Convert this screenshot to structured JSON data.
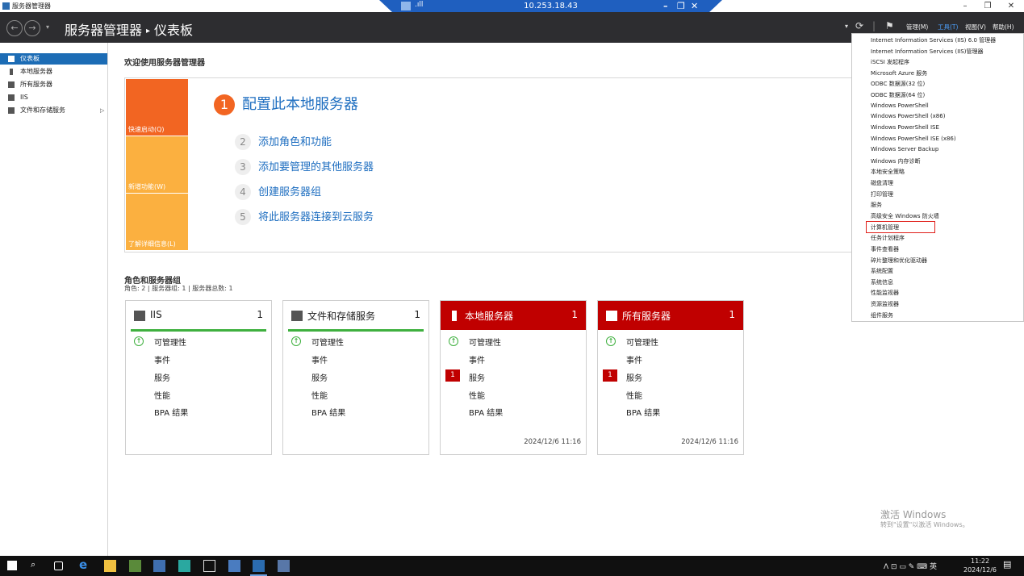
{
  "window": {
    "title": "服务器管理器",
    "minimize": "–",
    "restore": "❐",
    "close": "✕"
  },
  "remote": {
    "ip": "10.253.18.43",
    "signal": ".ıll",
    "min": "–",
    "restore": "❐",
    "close": "✕"
  },
  "header": {
    "breadcrumb": [
      "服务器管理器",
      "仪表板"
    ],
    "breadcrumb_sep": "▸",
    "menus": [
      "管理(M)",
      "工具(T)",
      "视图(V)",
      "帮助(H)"
    ],
    "refresh_icon": "⟳",
    "flag_icon": "⚑",
    "dropdown_arrow": "▾"
  },
  "sidebar": {
    "items": [
      {
        "label": "仪表板",
        "selected": true
      },
      {
        "label": "本地服务器"
      },
      {
        "label": "所有服务器"
      },
      {
        "label": "IIS"
      },
      {
        "label": "文件和存储服务",
        "arrow": "▷"
      }
    ]
  },
  "main": {
    "welcome": "欢迎使用服务器管理器",
    "quickstart": {
      "tiles": [
        "快速启动(Q)",
        "新增功能(W)",
        "了解详细信息(L)"
      ],
      "steps": [
        {
          "num": "1",
          "label": "配置此本地服务器"
        },
        {
          "num": "2",
          "label": "添加角色和功能"
        },
        {
          "num": "3",
          "label": "添加要管理的其他服务器"
        },
        {
          "num": "4",
          "label": "创建服务器组"
        },
        {
          "num": "5",
          "label": "将此服务器连接到云服务"
        }
      ]
    },
    "roles": {
      "title": "角色和服务器组",
      "subtitle": "角色: 2 | 服务器组: 1 | 服务器总数: 1",
      "cards": [
        {
          "title": "IIS",
          "count": "1",
          "rows": [
            "可管理性",
            "事件",
            "服务",
            "性能",
            "BPA 结果"
          ],
          "ok": "↑"
        },
        {
          "title": "文件和存储服务",
          "count": "1",
          "rows": [
            "可管理性",
            "事件",
            "服务",
            "性能",
            "BPA 结果"
          ],
          "ok": "↑"
        },
        {
          "title": "本地服务器",
          "count": "1",
          "rows": [
            "可管理性",
            "事件",
            "服务",
            "性能",
            "BPA 结果"
          ],
          "ok": "↑",
          "badge": "1",
          "timestamp": "2024/12/6 11:16"
        },
        {
          "title": "所有服务器",
          "count": "1",
          "rows": [
            "可管理性",
            "事件",
            "服务",
            "性能",
            "BPA 结果"
          ],
          "ok": "↑",
          "badge": "1",
          "timestamp": "2024/12/6 11:16"
        }
      ]
    }
  },
  "tools_menu": [
    "Internet Information Services (IIS) 6.0 管理器",
    "Internet Information Services (IIS)管理器",
    "iSCSI 发起程序",
    "Microsoft Azure 服务",
    "ODBC 数据源(32 位)",
    "ODBC 数据源(64 位)",
    "Windows PowerShell",
    "Windows PowerShell (x86)",
    "Windows PowerShell ISE",
    "Windows PowerShell ISE (x86)",
    "Windows Server Backup",
    "Windows 内存诊断",
    "本地安全策略",
    "磁盘清理",
    "打印管理",
    "服务",
    "高级安全 Windows 防火墙",
    "计算机管理",
    "任务计划程序",
    "事件查看器",
    "碎片整理和优化驱动器",
    "系统配置",
    "系统信息",
    "性能监视器",
    "资源监视器",
    "组件服务"
  ],
  "watermark": {
    "line1": "激活 Windows",
    "line2": "转到\"设置\"以激活 Windows。"
  },
  "taskbar": {
    "tray": "ᐱ  ⊡  ▭  ✎  ⌨  英",
    "time": "11:22",
    "date": "2024/12/6",
    "notify_icon": "▤"
  },
  "colors": {
    "accent": "#1c6cb5",
    "header_bg": "#2d2d30",
    "orange": "#f26522",
    "tile_light": "#fbb040",
    "red": "#c00000",
    "green": "#3fb03f",
    "highlight_box": "#e0201a"
  }
}
